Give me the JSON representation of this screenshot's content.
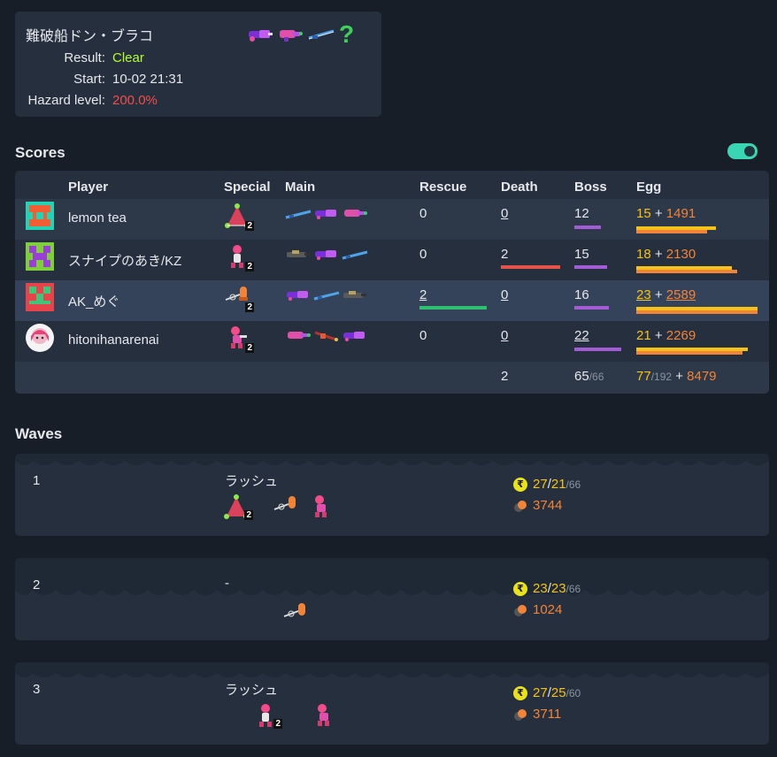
{
  "stage": {
    "name": "難破船ドン・ブラコ",
    "result_label": "Result:",
    "result_value": "Clear",
    "start_label": "Start:",
    "start_value": "10-02 21:31",
    "hazard_label": "Hazard level:",
    "hazard_value": "200.0%",
    "unknown_weapon_glyph": "?"
  },
  "scores": {
    "heading": "Scores",
    "toggle_on": true,
    "columns": [
      "Player",
      "Special",
      "Main",
      "Rescue",
      "Death",
      "Boss",
      "Egg"
    ],
    "players": [
      {
        "name": "lemon tea",
        "special_count": "2",
        "rescue": "0",
        "death": "0",
        "boss": "12",
        "golden": "15",
        "plus": "+",
        "power": "1491"
      },
      {
        "name": "スナイプのあき/KZ",
        "special_count": "2",
        "rescue": "0",
        "death": "2",
        "boss": "15",
        "golden": "18",
        "plus": "+",
        "power": "2130"
      },
      {
        "name": "AK_めぐ",
        "special_count": "2",
        "rescue": "2",
        "death": "0",
        "boss": "16",
        "golden": "23",
        "plus": "+",
        "power": "2589"
      },
      {
        "name": "hitonihanarenai",
        "special_count": "2",
        "rescue": "0",
        "death": "0",
        "boss": "22",
        "golden": "21",
        "plus": "+",
        "power": "2269"
      }
    ],
    "totals": {
      "death": "2",
      "boss": "65",
      "boss_of": "/66",
      "golden": "77",
      "golden_of": "/192",
      "plus": "+",
      "power": "8479"
    }
  },
  "waves": {
    "heading": "Waves",
    "items": [
      {
        "num": "1",
        "event": "ラッシュ",
        "golden": "27",
        "quota": "21",
        "of": "/66",
        "power": "3744",
        "special_count": "2",
        "sep": "/"
      },
      {
        "num": "2",
        "event": "-",
        "golden": "23",
        "quota": "23",
        "of": "/66",
        "power": "1024",
        "special_count": "",
        "sep": "/"
      },
      {
        "num": "3",
        "event": "ラッシュ",
        "golden": "27",
        "quota": "25",
        "of": "/60",
        "power": "3711",
        "special_count": "2",
        "sep": "/"
      }
    ]
  },
  "colors": {
    "clear": "#b5ff2e",
    "hazard": "#f24d4d",
    "golden_egg": "#f5c21a",
    "power_egg": "#f2843a",
    "boss_bar": "#a35bd6",
    "death_bar": "#e5534b",
    "rescue_bar": "#2fbf71",
    "toggle": "#3ad6b4"
  },
  "icons": {
    "gold_coin": "₹"
  }
}
